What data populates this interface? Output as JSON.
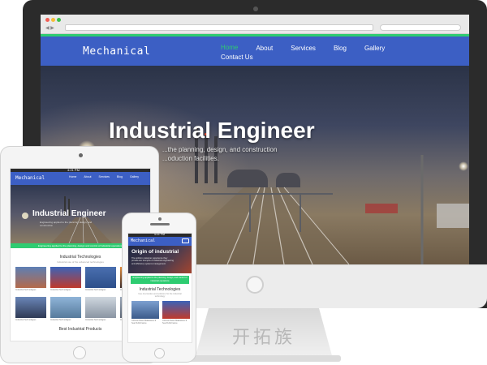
{
  "desktop": {
    "logo": "Mechanical",
    "nav": [
      {
        "label": "Home"
      },
      {
        "label": "About"
      },
      {
        "label": "Services"
      },
      {
        "label": "Blog"
      },
      {
        "label": "Gallery"
      }
    ],
    "nav_sub": "Contact Us",
    "hero_title": "Industrial Engineer",
    "hero_sub": "...the planning, design, and construction ...oduction facilities."
  },
  "tablet": {
    "status": "4:21 PM",
    "logo": "Mechanical",
    "nav": [
      "Home",
      "About",
      "Services",
      "Blog",
      "Gallery"
    ],
    "hero_title": "Industrial Engineer",
    "hero_sub": "Engineering applied to the planning, design, and construction",
    "green_banner": "Engineering applied to the planning, design and control of industrial operations",
    "section_title": "Industrial Technologies",
    "section_sub": "Industrial use of the advanced technologies",
    "cards": [
      {
        "caption": "Industrial Technologies"
      },
      {
        "caption": "Industrial Technologies"
      },
      {
        "caption": "Industrial Technologies"
      },
      {
        "caption": "Industrial Technologies"
      },
      {
        "caption": "Industrial Technologies"
      },
      {
        "caption": "Industrial Technologies"
      },
      {
        "caption": "Industrial Technologies"
      },
      {
        "caption": "Industrial Technologies"
      }
    ],
    "bottom_title": "Best Industrial Products"
  },
  "phone": {
    "status": "4:21 PM",
    "logo": "Mechanical",
    "hero_title": "Origin of industrial",
    "hero_sub": "The uniform customer experience they provide are triumphs of industrial engineering and efficiency systems management.",
    "green_banner": "Engineering applied to the planning, design, and control of industrial operations",
    "section_title": "Industrial Technologies",
    "section_sub": "Use of provides and solutions for the industrial technology",
    "cards": [
      {
        "caption": "Orthodo Rekst Malaratese & Sea Performance"
      },
      {
        "caption": "Orthodo Rekst Malaratese & Sea Performance"
      }
    ]
  },
  "watermark": "开拓族",
  "colors": {
    "brand_blue": "#3c5fc4",
    "accent_green": "#2ecc71",
    "bezel": "#2b2b2b"
  }
}
